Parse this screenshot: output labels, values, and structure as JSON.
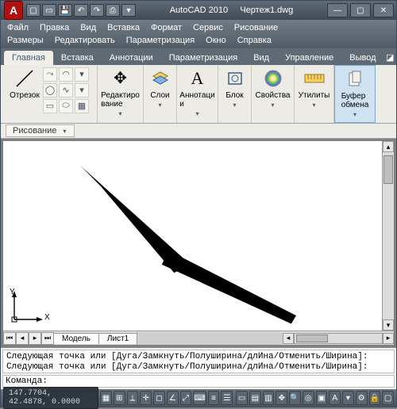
{
  "titlebar": {
    "app": "AutoCAD 2010",
    "doc": "Чертеж1.dwg",
    "logo": "A"
  },
  "menus1": [
    "Файл",
    "Правка",
    "Вид",
    "Вставка",
    "Формат",
    "Сервис",
    "Рисование"
  ],
  "menus2": [
    "Размеры",
    "Редактировать",
    "Параметризация",
    "Окно",
    "Справка"
  ],
  "ribbon_tabs": [
    "Главная",
    "Вставка",
    "Аннотации",
    "Параметризация",
    "Вид",
    "Управление",
    "Вывод"
  ],
  "ribbon": {
    "draw_big": "Отрезок",
    "draw_panel": "Рисование",
    "edit_big": "Редактиро\nвание",
    "layer": "Слои",
    "anno": "Аннотаци\nи",
    "block": "Блок",
    "props": "Свойства",
    "util": "Утилиты",
    "clip": "Буфер\nобмена"
  },
  "sheets": {
    "model": "Модель",
    "sheet1": "Лист1"
  },
  "cmd": {
    "hist1": "Следующая точка или [Дуга/Замкнуть/Полуширина/длИна/Отменить/Ширина]:",
    "hist2": "Следующая точка или [Дуга/Замкнуть/Полуширина/длИна/Отменить/Ширина]:",
    "prompt": "Команда:"
  },
  "status": {
    "coords": "147.7704, 42.4878, 0.0000"
  },
  "axes": {
    "x": "X",
    "y": "Y"
  }
}
